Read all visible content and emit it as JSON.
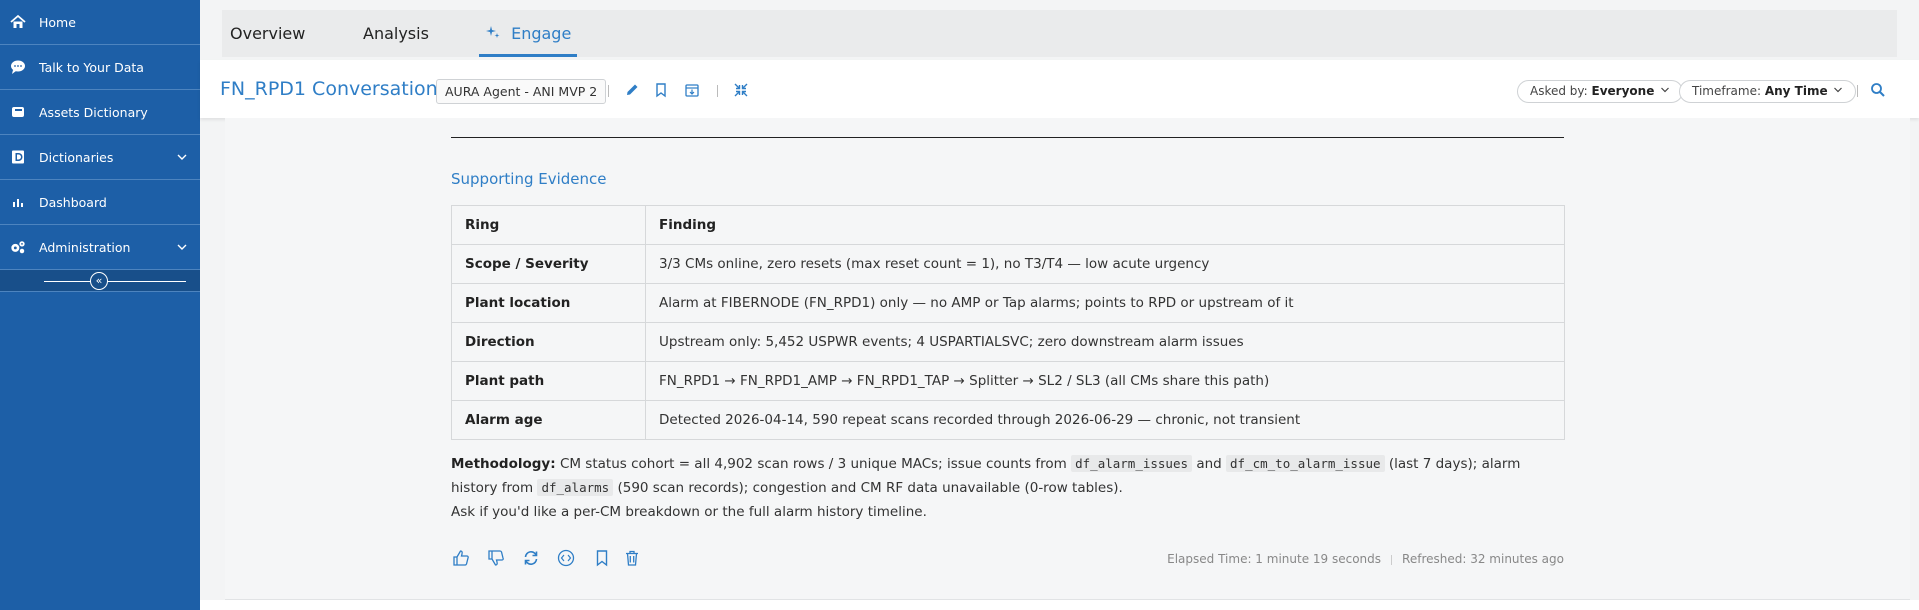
{
  "sidebar": {
    "items": [
      {
        "label": "Home",
        "icon": "home-icon"
      },
      {
        "label": "Talk to Your Data",
        "icon": "chat-icon"
      },
      {
        "label": "Assets Dictionary",
        "icon": "dictionary-icon"
      },
      {
        "label": "Dictionaries",
        "icon": "book-icon"
      },
      {
        "label": "Dashboard",
        "icon": "bar-chart-icon"
      },
      {
        "label": "Administration",
        "icon": "gears-icon"
      }
    ],
    "collapse_glyph": "«"
  },
  "tabs": [
    {
      "label": "Overview"
    },
    {
      "label": "Analysis"
    },
    {
      "label": "Engage"
    }
  ],
  "toolbar": {
    "title": "FN_RPD1 Conversation",
    "agent": "AURA Agent - ANI MVP 2",
    "asked_by_label": "Asked by:",
    "asked_by_value": "Everyone",
    "timeframe_label": "Timeframe:",
    "timeframe_value": "Any Time"
  },
  "content": {
    "section_title": "Supporting Evidence",
    "table": {
      "headers": [
        "Ring",
        "Finding"
      ],
      "rows": [
        {
          "ring": "Scope / Severity",
          "finding": "3/3 CMs online, zero resets (max reset count = 1), no T3/T4 — low acute urgency"
        },
        {
          "ring": "Plant location",
          "finding": "Alarm at FIBERNODE (FN_RPD1) only — no AMP or Tap alarms; points to RPD or upstream of it"
        },
        {
          "ring": "Direction",
          "finding": "Upstream only: 5,452 USPWR events; 4 USPARTIALSVC; zero downstream alarm issues"
        },
        {
          "ring": "Plant path",
          "finding": "FN_RPD1 → FN_RPD1_AMP → FN_RPD1_TAP → Splitter → SL2 / SL3 (all CMs share this path)"
        },
        {
          "ring": "Alarm age",
          "finding": "Detected 2026-04-14, 590 repeat scans recorded through 2026-06-29 — chronic, not transient"
        }
      ]
    },
    "methodology": {
      "label": "Methodology:",
      "text1": "CM status cohort = all 4,902 scan rows / 3 unique MACs; issue counts from",
      "code1": "df_alarm_issues",
      "text2": "and",
      "code2": "df_cm_to_alarm_issue",
      "text3": "(last 7 days); alarm history from",
      "code3": "df_alarms",
      "text4": "(590 scan records); congestion and CM RF data unavailable (0-row tables).",
      "followup": "Ask if you'd like a per-CM breakdown or the full alarm history timeline."
    },
    "meta": {
      "elapsed": "Elapsed Time: 1 minute 19 seconds",
      "refreshed": "Refreshed: 32 minutes ago"
    }
  },
  "colors": {
    "sidebar": "#1d5fa7",
    "accent": "#2f7ec6"
  }
}
